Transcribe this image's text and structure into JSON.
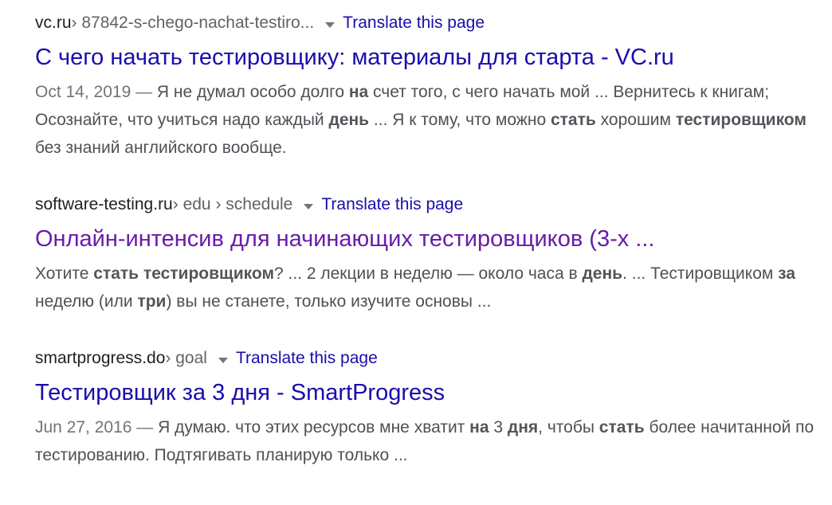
{
  "results": [
    {
      "cite_domain": "vc.ru",
      "cite_path": " › 87842-s-chego-nachat-testiro...",
      "translate_label": "Translate this page",
      "title": "С чего начать тестировщику: материалы для старта - VC.ru",
      "date": "Oct 14, 2019 — ",
      "snippet": [
        {
          "t": "Я не думал особо долго ",
          "b": false
        },
        {
          "t": "на",
          "b": true
        },
        {
          "t": " счет того, с чего начать мой ... Вернитесь к книгам; Осознайте, что учиться надо каждый ",
          "b": false
        },
        {
          "t": "день",
          "b": true
        },
        {
          "t": " ... Я к тому, что можно ",
          "b": false
        },
        {
          "t": "стать",
          "b": true
        },
        {
          "t": " хорошим ",
          "b": false
        },
        {
          "t": "тестировщиком",
          "b": true
        },
        {
          "t": " без знаний английского вообще.",
          "b": false
        }
      ]
    },
    {
      "cite_domain": "software-testing.ru",
      "cite_path": " › edu › schedule",
      "translate_label": "Translate this page",
      "title": "Онлайн-интенсив для начинающих тестировщиков (3-х ...",
      "date": "",
      "snippet": [
        {
          "t": "Хотите ",
          "b": false
        },
        {
          "t": "стать тестировщиком",
          "b": true
        },
        {
          "t": "? ... 2 лекции в неделю — около часа в ",
          "b": false
        },
        {
          "t": "день",
          "b": true
        },
        {
          "t": ". ... Тестировщиком ",
          "b": false
        },
        {
          "t": "за",
          "b": true
        },
        {
          "t": " неделю (или ",
          "b": false
        },
        {
          "t": "три",
          "b": true
        },
        {
          "t": ") вы не станете, только изучите основы ...",
          "b": false
        }
      ]
    },
    {
      "cite_domain": "smartprogress.do",
      "cite_path": " › goal",
      "translate_label": "Translate this page",
      "title": "Тестировщик за 3 дня - SmartProgress",
      "date": "Jun 27, 2016 — ",
      "snippet": [
        {
          "t": "Я думаю. что этих ресурсов мне хватит ",
          "b": false
        },
        {
          "t": "на",
          "b": true
        },
        {
          "t": " 3 ",
          "b": false
        },
        {
          "t": "дня",
          "b": true
        },
        {
          "t": ", чтобы ",
          "b": false
        },
        {
          "t": "стать",
          "b": true
        },
        {
          "t": " более начитанной по тестированию. Подтягивать планирую только ...",
          "b": false
        }
      ]
    }
  ],
  "colors": {
    "link": "#1a0dab",
    "visited_link": "#681da8",
    "snippet_text": "#4d5156",
    "cite_text": "#202124",
    "muted": "#70757a"
  }
}
